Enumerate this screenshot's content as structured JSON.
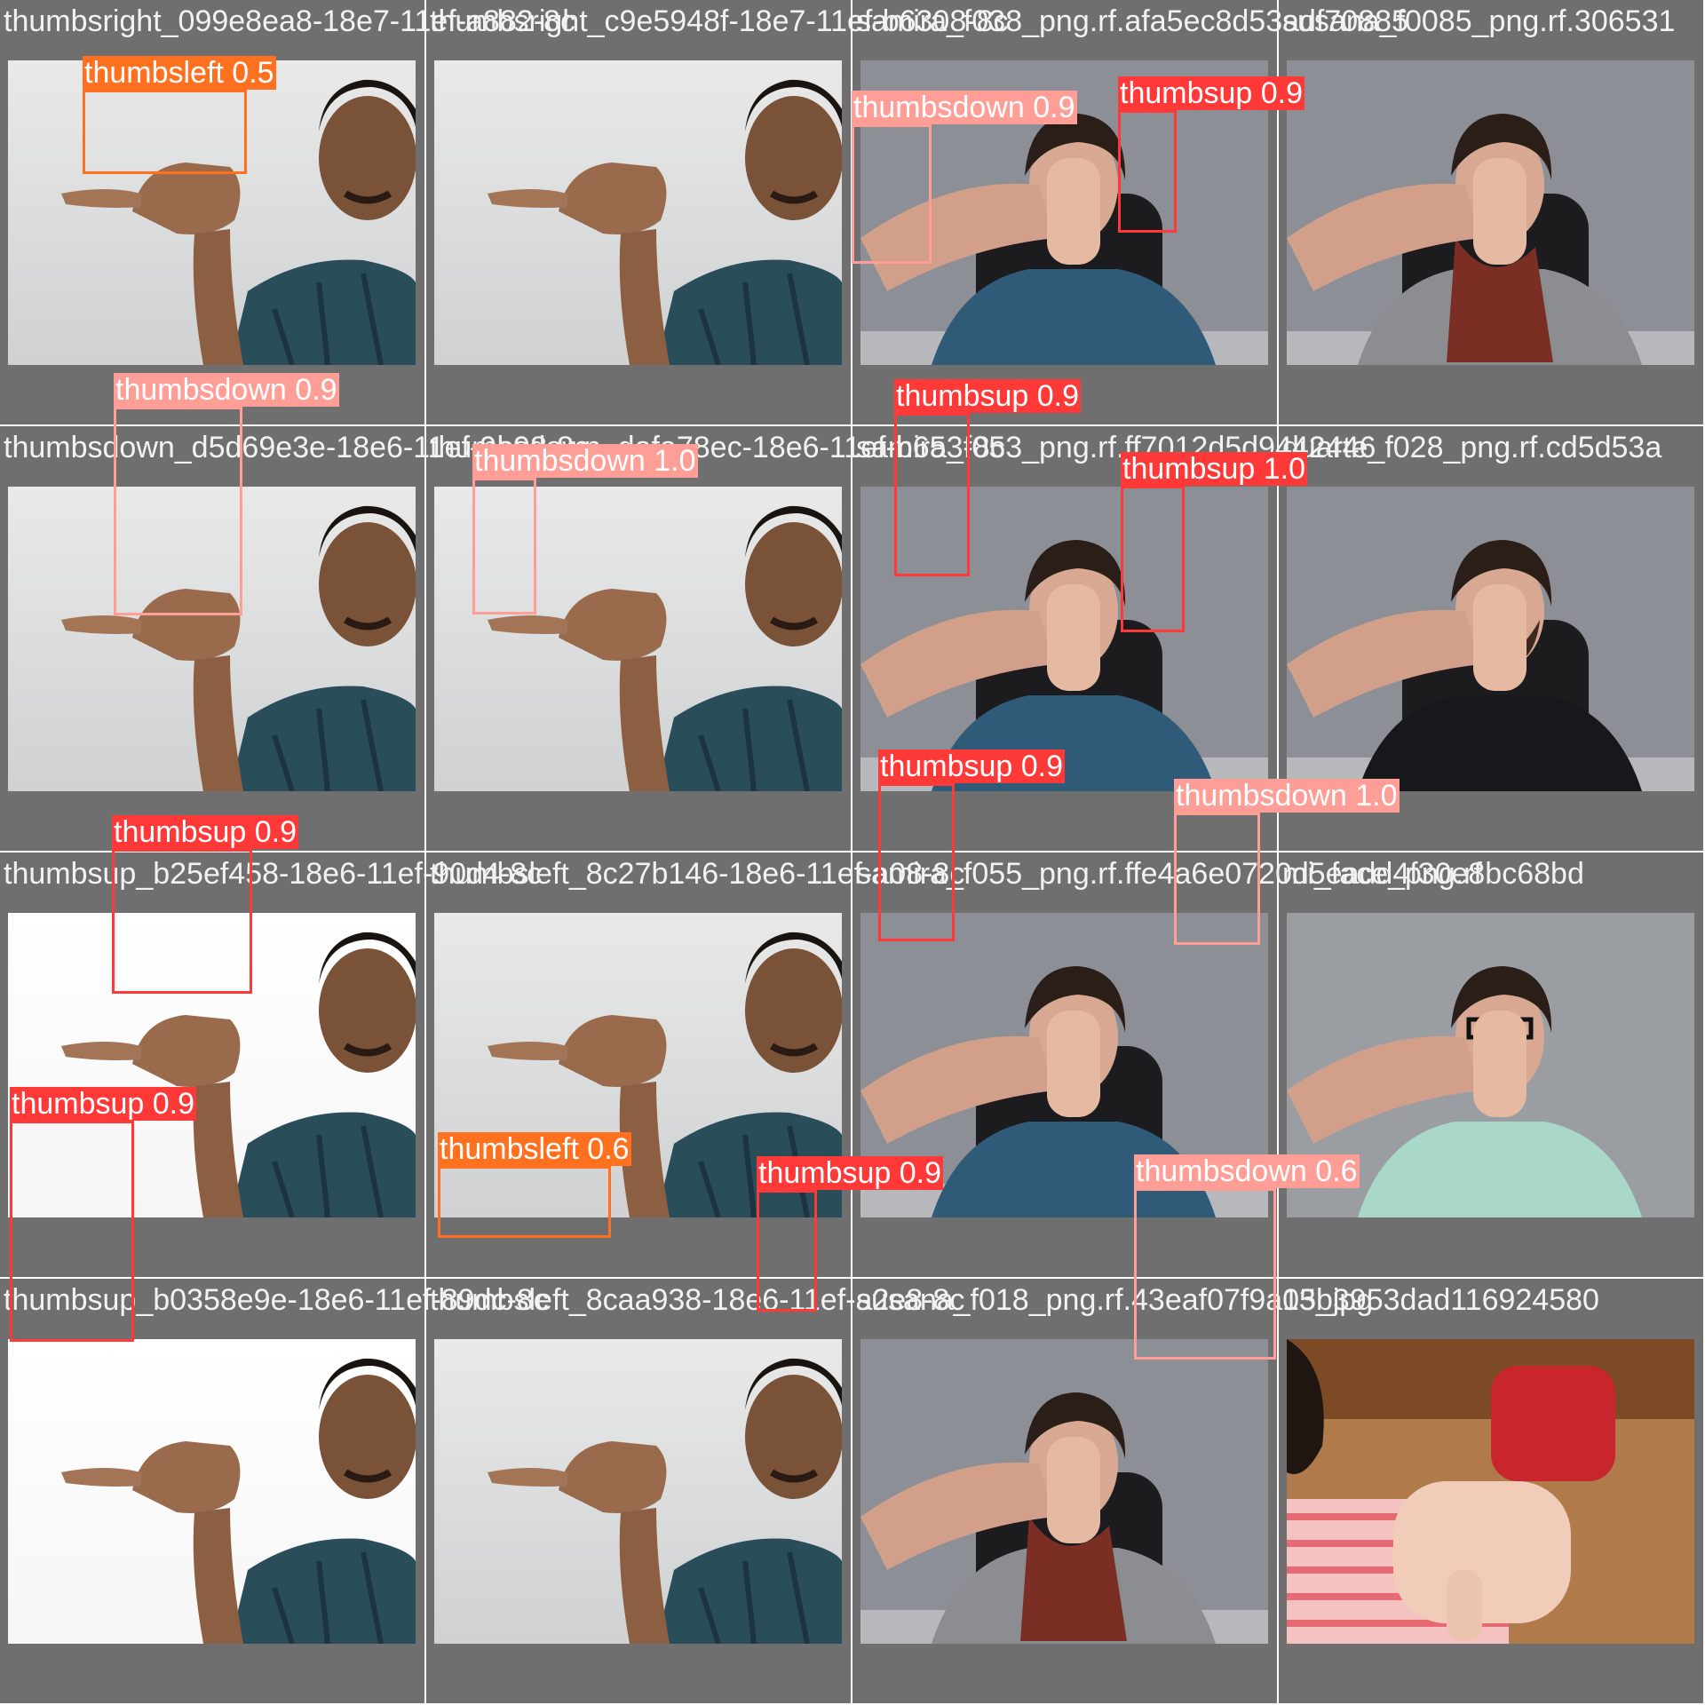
{
  "colors": {
    "thumbsup": "#ff3838",
    "thumbsdown": "#ff9d97",
    "thumbsleft": "#ff701f",
    "tile_background": "#6f6f6f",
    "title_text": "#f2f2f2"
  },
  "tiles": [
    {
      "title": "thumbsright_099e8ea8-18e7-11ef-a882-8c",
      "scene": "wall-man",
      "detections": [
        {
          "label": "thumbsleft 0.5",
          "class": "thumbsleft"
        }
      ]
    },
    {
      "title": "thumbsright_c9e5948f-18e7-11ef-b6308-8c",
      "scene": "wall-man",
      "detections": []
    },
    {
      "title": "samira_f038_png.rf.afa5ec8d53adf70885",
      "scene": "chair-woman",
      "detections": [
        {
          "label": "thumbsdown 0.9",
          "class": "thumbsdown"
        }
      ]
    },
    {
      "title": "susana_f0085_png.rf.306531",
      "scene": "scarf-woman",
      "detections": [
        {
          "label": "thumbsup 0.9",
          "class": "thumbsup"
        }
      ]
    },
    {
      "title": "thumbsdown_d5d69e3e-18e6-11ef-9a98-8c",
      "scene": "wall-man",
      "detections": [
        {
          "label": "thumbsdown 0.9",
          "class": "thumbsdown"
        }
      ]
    },
    {
      "title": "thumbsdown_dafa78ec-18e6-11ef-b653-8c",
      "scene": "wall-man",
      "detections": [
        {
          "label": "thumbsdown 1.0",
          "class": "thumbsdown"
        }
      ]
    },
    {
      "title": "samira_f053_png.rf.ff7012d5d9442446",
      "scene": "chair-woman",
      "detections": [
        {
          "label": "thumbsup 0.9",
          "class": "thumbsup"
        }
      ]
    },
    {
      "title": "duarte_f028_png.rf.cd5d53a",
      "scene": "beard-man",
      "detections": [
        {
          "label": "thumbsup 1.0",
          "class": "thumbsup"
        }
      ]
    },
    {
      "title": "thumbsup_b25ef458-18e6-11ef-90d4-8c",
      "scene": "white-man",
      "detections": [
        {
          "label": "thumbsup 0.9",
          "class": "thumbsup"
        }
      ]
    },
    {
      "title": "thumbsleft_8c27b146-18e6-11ef-a08-8c",
      "scene": "wall-man",
      "detections": []
    },
    {
      "title": "samira_f055_png.rf.ffe4a6e0720d5eadd4f30e8bc68bd",
      "scene": "chair-woman",
      "detections": [
        {
          "label": "thumbsup 0.9",
          "class": "thumbsup"
        }
      ]
    },
    {
      "title": "mi_face_png.rf",
      "scene": "glasses-woman",
      "detections": [
        {
          "label": "thumbsdown 1.0",
          "class": "thumbsdown"
        }
      ]
    },
    {
      "title": "thumbsup_b0358e9e-18e6-11ef-89dc-8c",
      "scene": "white-man",
      "detections": [
        {
          "label": "thumbsup 0.9",
          "class": "thumbsup"
        }
      ]
    },
    {
      "title": "thumbsleft_8caa938-18e6-11ef-a2e8-8c",
      "scene": "wall-man",
      "detections": [
        {
          "label": "thumbsleft 0.6",
          "class": "thumbsleft"
        }
      ]
    },
    {
      "title": "susana_f018_png.rf.43eaf07f9a05b3953dad116924580",
      "scene": "scarf-woman",
      "detections": [
        {
          "label": "thumbsup 0.9",
          "class": "thumbsup"
        }
      ]
    },
    {
      "title": "13_jpg",
      "scene": "child",
      "detections": [
        {
          "label": "thumbsdown 0.6",
          "class": "thumbsdown"
        }
      ]
    }
  ]
}
